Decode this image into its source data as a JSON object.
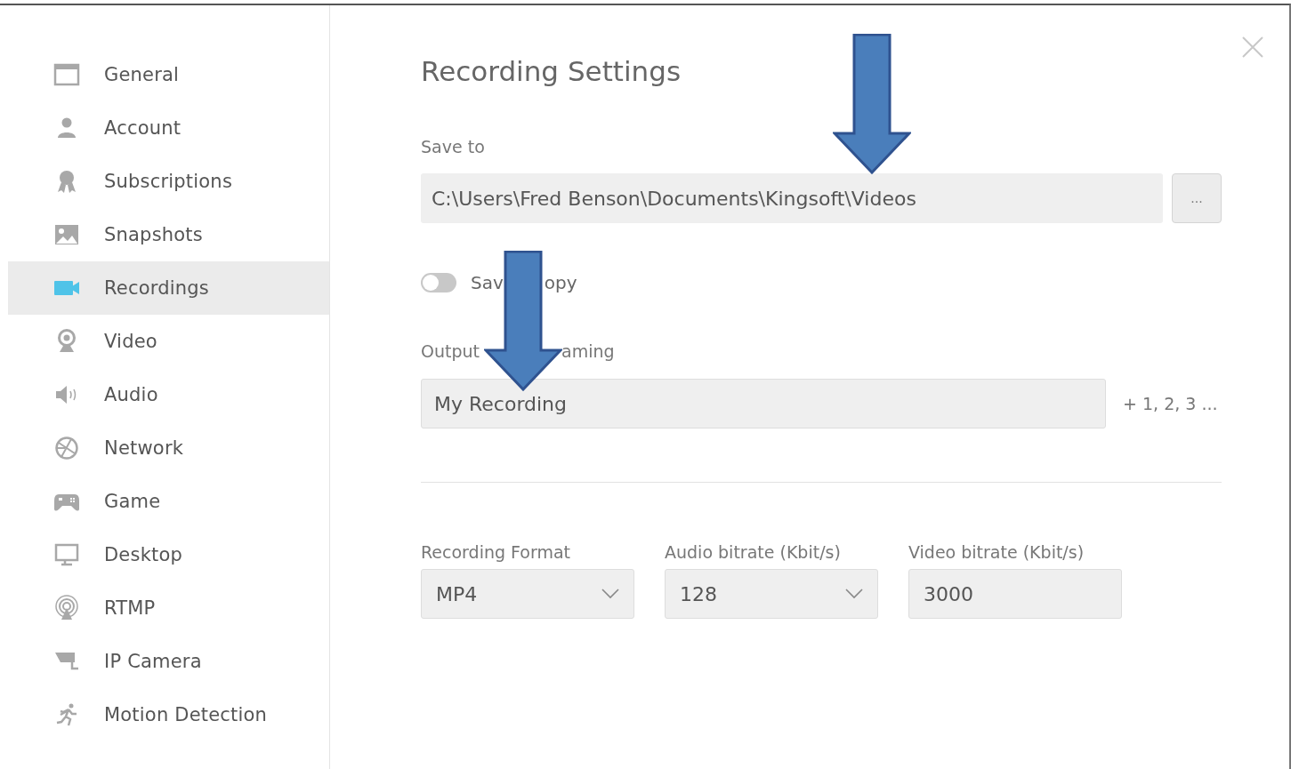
{
  "sidebar": {
    "items": [
      {
        "label": "General",
        "selected": false
      },
      {
        "label": "Account",
        "selected": false
      },
      {
        "label": "Subscriptions",
        "selected": false
      },
      {
        "label": "Snapshots",
        "selected": false
      },
      {
        "label": "Recordings",
        "selected": true
      },
      {
        "label": "Video",
        "selected": false
      },
      {
        "label": "Audio",
        "selected": false
      },
      {
        "label": "Network",
        "selected": false
      },
      {
        "label": "Game",
        "selected": false
      },
      {
        "label": "Desktop",
        "selected": false
      },
      {
        "label": "RTMP",
        "selected": false
      },
      {
        "label": "IP Camera",
        "selected": false
      },
      {
        "label": "Motion Detection",
        "selected": false
      }
    ]
  },
  "content": {
    "title": "Recording Settings",
    "save_to": {
      "label": "Save to",
      "value": "C:\\Users\\Fred Benson\\Documents\\Kingsoft\\Videos",
      "browse_button": "..."
    },
    "save_copy": {
      "on": false,
      "label_parts": [
        "Sav",
        "opy"
      ]
    },
    "output_naming": {
      "label_parts": [
        "Output",
        "aming"
      ],
      "value": "My Recording",
      "suffix": "+ 1, 2, 3 ..."
    },
    "format_fields": [
      {
        "kind": "select",
        "label": "Recording Format",
        "value": "MP4"
      },
      {
        "kind": "select",
        "label": "Audio bitrate (Kbit/s)",
        "value": "128"
      },
      {
        "kind": "text",
        "label": "Video bitrate (Kbit/s)",
        "value": "3000"
      }
    ]
  }
}
